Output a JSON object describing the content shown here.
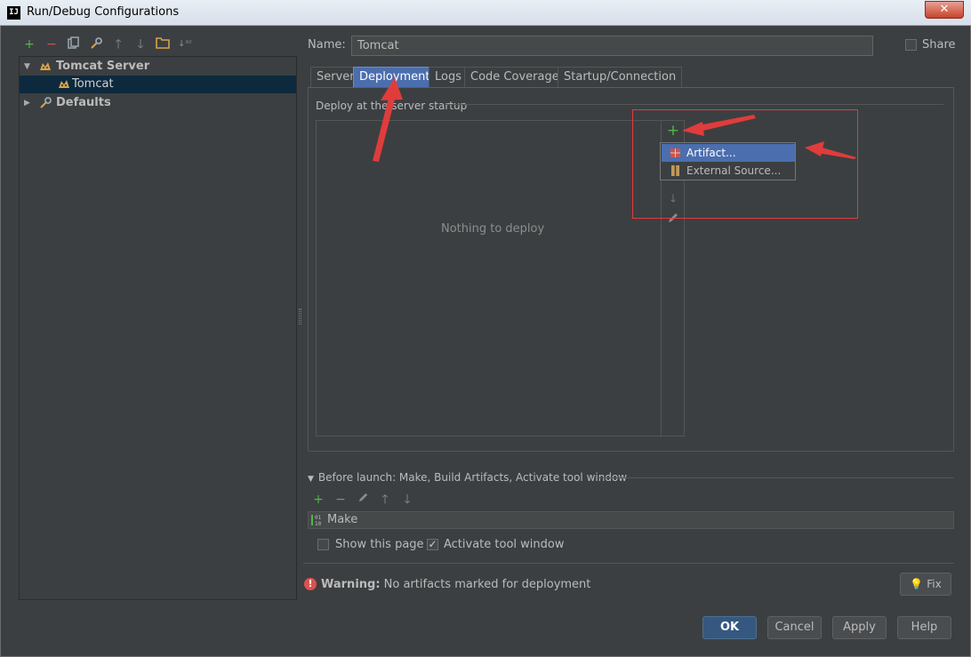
{
  "window": {
    "app_icon": "IJ",
    "title": "Run/Debug Configurations",
    "close_label": "✕"
  },
  "left_toolbar": {
    "icons": [
      "add-icon",
      "remove-icon",
      "copy-icon",
      "edit-defaults-icon",
      "move-up-icon",
      "move-down-icon",
      "folder-icon",
      "sort-icon"
    ]
  },
  "tree": {
    "items": [
      {
        "label": "Tomcat Server",
        "expanded": true
      },
      {
        "label": "Tomcat",
        "selected": true
      },
      {
        "label": "Defaults",
        "expanded": false
      }
    ]
  },
  "name_field": {
    "label": "Name:",
    "value": "Tomcat",
    "share_label": "Share",
    "share_checked": false
  },
  "tabs": [
    {
      "label": "Server"
    },
    {
      "label": "Deployment",
      "active": true
    },
    {
      "label": "Logs"
    },
    {
      "label": "Code Coverage"
    },
    {
      "label": "Startup/Connection"
    }
  ],
  "deployment": {
    "section_label": "Deploy at the server startup",
    "empty_text": "Nothing to deploy",
    "popup": {
      "items": [
        {
          "label": "Artifact...",
          "selected": true
        },
        {
          "label": "External Source..."
        }
      ]
    }
  },
  "before_launch": {
    "label": "Before launch: Make, Build Artifacts, Activate tool window",
    "items": [
      {
        "label": "Make"
      }
    ],
    "show_page_label": "Show this page",
    "show_page_checked": false,
    "activate_label": "Activate tool window",
    "activate_checked": true
  },
  "warning": {
    "bold": "Warning:",
    "text": "No artifacts marked for deployment",
    "fix_label": "Fix"
  },
  "buttons": {
    "ok": "OK",
    "cancel": "Cancel",
    "apply": "Apply",
    "help": "Help"
  },
  "colors": {
    "background": "#3c3f41",
    "accent": "#4b6eaf",
    "annotation": "#e03c3c"
  }
}
